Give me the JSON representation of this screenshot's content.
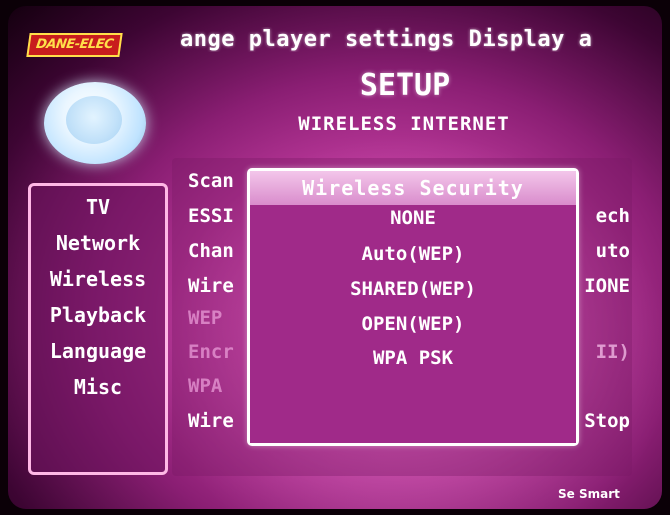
{
  "brand": {
    "logo_text": "DANE-ELEC"
  },
  "ticker": {
    "text": "ange player settings  Display a"
  },
  "header": {
    "title": "SETUP",
    "subtitle": "WIRELESS INTERNET"
  },
  "icons": {
    "globe": "globe-icon"
  },
  "sidebar": {
    "items": [
      {
        "label": "TV"
      },
      {
        "label": "Network"
      },
      {
        "label": "Wireless"
      },
      {
        "label": "Playback"
      },
      {
        "label": "Language"
      },
      {
        "label": "Misc"
      }
    ]
  },
  "settings": {
    "rows": [
      {
        "label": "Scan",
        "value": ""
      },
      {
        "label": "ESSI",
        "value": "ech"
      },
      {
        "label": "Chan",
        "value": "uto"
      },
      {
        "label": "Wire",
        "value": "IONE"
      },
      {
        "label": "WEP",
        "value": ""
      },
      {
        "label": "Encr",
        "value": "II)"
      },
      {
        "label": "WPA",
        "value": ""
      },
      {
        "label": "Wire",
        "value": "Stop"
      }
    ]
  },
  "popup": {
    "title": "Wireless Security",
    "options": [
      {
        "label": "NONE"
      },
      {
        "label": "Auto(WEP)"
      },
      {
        "label": "SHARED(WEP)"
      },
      {
        "label": "OPEN(WEP)"
      },
      {
        "label": "WPA PSK"
      }
    ]
  },
  "footer": {
    "brand_text": "Se Smart"
  },
  "colors": {
    "background_magenta": "#c73fa4",
    "popup_background": "#a02a89",
    "logo_red": "#c81d1d",
    "logo_yellow": "#ffe04a"
  }
}
